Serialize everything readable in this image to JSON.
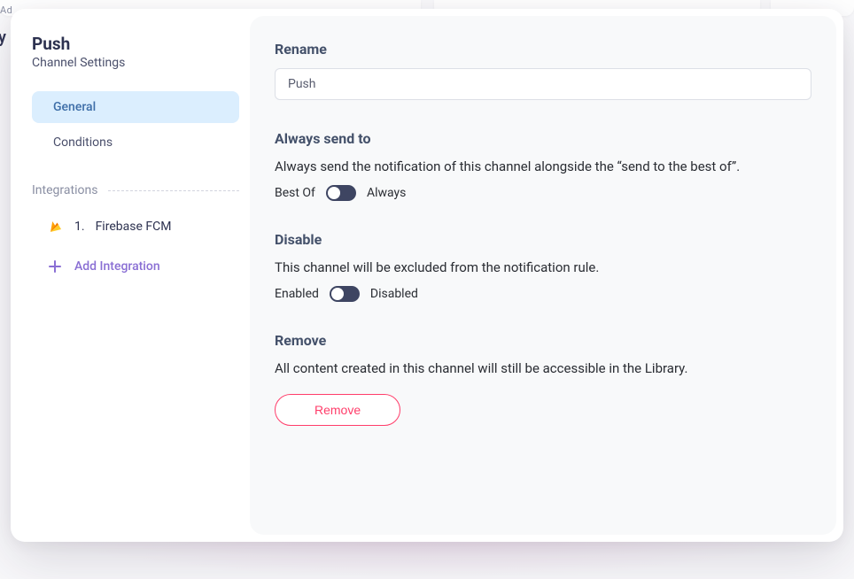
{
  "backdrop": {
    "label_a": "Ad"
  },
  "sidebar": {
    "title": "Push",
    "subtitle": "Channel Settings",
    "nav": [
      {
        "label": "General",
        "active": true
      },
      {
        "label": "Conditions",
        "active": false
      }
    ],
    "integrations_label": "Integrations",
    "integrations": [
      {
        "index": "1.",
        "name": "Firebase FCM",
        "icon": "firebase-icon"
      }
    ],
    "add_integration_label": "Add Integration"
  },
  "main": {
    "rename": {
      "heading": "Rename",
      "value": "Push"
    },
    "always_send": {
      "heading": "Always send to",
      "description": "Always send the notification of this channel alongside the “send to the best of”.",
      "left_label": "Best Of",
      "right_label": "Always",
      "state": "off"
    },
    "disable": {
      "heading": "Disable",
      "description": "This channel will be excluded from the notification rule.",
      "left_label": "Enabled",
      "right_label": "Disabled",
      "state": "off"
    },
    "remove": {
      "heading": "Remove",
      "description": "All content created in this channel will still be accessible in the Library.",
      "button_label": "Remove"
    }
  }
}
